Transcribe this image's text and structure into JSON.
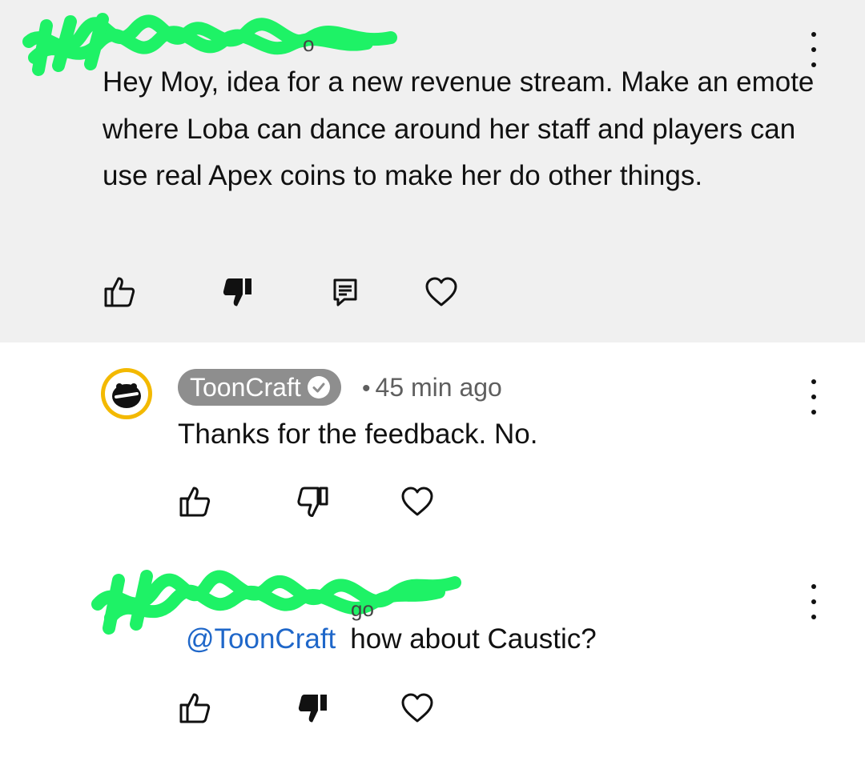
{
  "colors": {
    "highlighted_bg": "#f0f0f0",
    "scribble": "#1ef266",
    "mention": "#1f67c9",
    "author_badge": "#8e8e8e",
    "avatar_ring": "#f3b900"
  },
  "comments": [
    {
      "author_redacted": true,
      "text": "Hey Moy, idea for a new revenue stream. Make an emote where Loba can dance around her staff and players can use real Apex coins to make her do other things.",
      "dislike_state": "selected",
      "icons": [
        "thumbs-up-icon",
        "thumbs-down-icon",
        "reply-icon",
        "heart-icon",
        "more-vert-icon"
      ]
    },
    {
      "author": "ToonCraft",
      "verified": true,
      "time": "45 min ago",
      "text": "Thanks for the feedback. No.",
      "icons": [
        "thumbs-up-icon",
        "thumbs-down-icon",
        "heart-icon",
        "more-vert-icon"
      ]
    },
    {
      "author_redacted": true,
      "mention": "@ToonCraft",
      "text": "how about Caustic?",
      "dislike_state": "selected",
      "icons": [
        "thumbs-up-icon",
        "thumbs-down-icon",
        "heart-icon",
        "more-vert-icon"
      ]
    }
  ]
}
